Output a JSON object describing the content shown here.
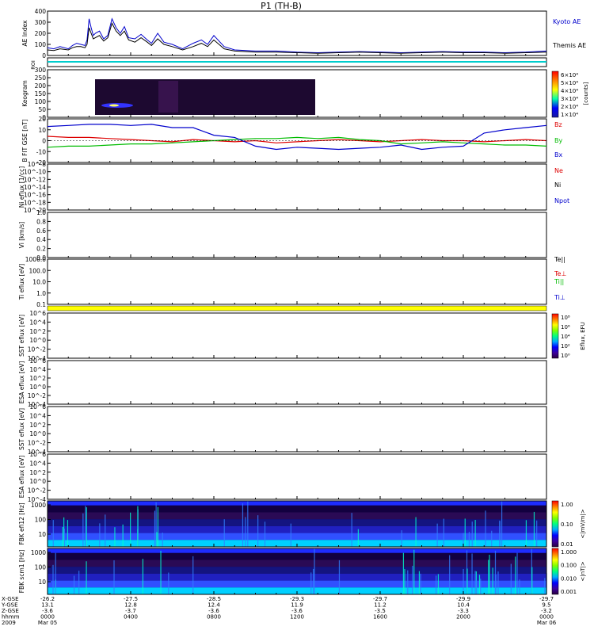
{
  "title": "P1 (TH-B)",
  "chart_data": [
    {
      "type": "line",
      "panel": "ae",
      "ylabel": "AE Index",
      "ylim": [
        0,
        400
      ],
      "y_ticks": [
        "0",
        "100",
        "200",
        "300",
        "400"
      ],
      "series": [
        {
          "name": "Kyoto AE",
          "color": "#0000cc",
          "x": [
            0,
            0.3,
            0.6,
            1.0,
            1.2,
            1.4,
            1.6,
            1.8,
            1.9,
            2.0,
            2.1,
            2.2,
            2.3,
            2.5,
            2.7,
            2.9,
            3.1,
            3.3,
            3.5,
            3.7,
            3.9,
            4.2,
            4.5,
            4.8,
            5.0,
            5.3,
            5.6,
            6.0,
            6.5,
            7.0,
            7.4,
            7.7,
            8.0,
            8.5,
            9,
            10,
            11,
            12,
            13,
            14,
            15,
            16,
            17,
            18,
            19,
            20,
            21,
            22,
            23,
            24
          ],
          "y": [
            70,
            60,
            80,
            60,
            90,
            110,
            100,
            90,
            140,
            330,
            250,
            180,
            200,
            220,
            150,
            180,
            330,
            250,
            200,
            260,
            160,
            150,
            190,
            140,
            110,
            200,
            120,
            100,
            60,
            110,
            140,
            100,
            180,
            80,
            50,
            40,
            40,
            30,
            25,
            30,
            35,
            30,
            25,
            30,
            35,
            30,
            30,
            25,
            30,
            40
          ]
        },
        {
          "name": "Themis AE",
          "color": "#000000",
          "x": [
            0,
            0.3,
            0.6,
            1.0,
            1.2,
            1.4,
            1.6,
            1.8,
            1.9,
            2.0,
            2.1,
            2.2,
            2.3,
            2.5,
            2.7,
            2.9,
            3.1,
            3.3,
            3.5,
            3.7,
            3.9,
            4.2,
            4.5,
            4.8,
            5.0,
            5.3,
            5.6,
            6.0,
            6.5,
            7.0,
            7.4,
            7.7,
            8.0,
            8.5,
            9,
            10,
            11,
            12,
            13,
            14,
            15,
            16,
            17,
            18,
            19,
            20,
            21,
            22,
            23,
            24
          ],
          "y": [
            50,
            45,
            60,
            50,
            70,
            80,
            80,
            70,
            100,
            250,
            200,
            150,
            160,
            180,
            130,
            160,
            290,
            220,
            180,
            220,
            140,
            120,
            160,
            120,
            90,
            150,
            100,
            80,
            50,
            80,
            110,
            80,
            140,
            60,
            40,
            30,
            30,
            25,
            20,
            25,
            30,
            25,
            20,
            25,
            30,
            25,
            25,
            20,
            25,
            30
          ]
        }
      ]
    },
    {
      "type": "line",
      "panel": "bfgm",
      "ylabel": "B FIT GSE [nT]",
      "ylim": [
        -20,
        20
      ],
      "y_ticks": [
        "20",
        "10",
        "0",
        "-10",
        "-20"
      ],
      "series": [
        {
          "name": "Bz",
          "color": "#dd0000",
          "x": [
            0,
            1,
            2,
            3,
            4,
            5,
            6,
            7,
            8,
            9,
            10,
            11,
            12,
            13,
            14,
            15,
            16,
            17,
            18,
            19,
            20,
            21,
            22,
            23,
            24
          ],
          "y": [
            4,
            3,
            3,
            2,
            1,
            0,
            -1,
            1,
            0,
            -1,
            0,
            -2,
            -1,
            0,
            1,
            0,
            -1,
            0,
            1,
            0,
            0,
            -1,
            0,
            1,
            0
          ]
        },
        {
          "name": "By",
          "color": "#00bb00",
          "x": [
            0,
            1,
            2,
            3,
            4,
            5,
            6,
            7,
            8,
            9,
            10,
            11,
            12,
            13,
            14,
            15,
            16,
            17,
            18,
            19,
            20,
            21,
            22,
            23,
            24
          ],
          "y": [
            -6,
            -5,
            -5,
            -4,
            -3,
            -3,
            -2,
            -1,
            0,
            1,
            2,
            2,
            3,
            2,
            3,
            1,
            0,
            -3,
            -2,
            -1,
            -2,
            -3,
            -4,
            -4,
            -5
          ]
        },
        {
          "name": "Bx",
          "color": "#0000cc",
          "x": [
            0,
            1,
            2,
            3,
            4,
            5,
            6,
            7,
            8,
            9,
            10,
            11,
            12,
            13,
            14,
            15,
            16,
            17,
            18,
            19,
            20,
            21,
            22,
            23,
            24
          ],
          "y": [
            13,
            14,
            15,
            15,
            14,
            15,
            12,
            12,
            5,
            3,
            -5,
            -8,
            -6,
            -7,
            -8,
            -7,
            -6,
            -4,
            -8,
            -6,
            -5,
            7,
            10,
            12,
            14
          ]
        }
      ]
    },
    {
      "type": "line",
      "panel": "ni",
      "ylabel": "Ni eflux [1/cc]",
      "y_ticks": [
        "10^-8",
        "10^-10",
        "10^-12",
        "10^-14",
        "10^-16",
        "10^-18",
        "10^-20"
      ],
      "series": [
        {
          "name": "Ne",
          "color": "#dd0000"
        },
        {
          "name": "Ni",
          "color": "#000000"
        },
        {
          "name": "Npot",
          "color": "#0000cc"
        }
      ]
    },
    {
      "type": "line",
      "panel": "vi",
      "ylabel": "Vi [km/s]",
      "ylim": [
        0,
        1
      ],
      "y_ticks": [
        "1.0",
        "0.8",
        "0.6",
        "0.4",
        "0.2",
        "0.0"
      ]
    },
    {
      "type": "line",
      "panel": "ti",
      "ylabel": "Ti eflux [eV]",
      "y_ticks": [
        "1000.0",
        "100.0",
        "10.0",
        "1.0",
        "0.1"
      ],
      "series": [
        {
          "name": "Te||",
          "color": "#000000"
        },
        {
          "name": "Te⊥",
          "color": "#dd0000"
        },
        {
          "name": "Ti||",
          "color": "#00bb00"
        },
        {
          "name": "Ti⊥",
          "color": "#0000cc"
        }
      ]
    },
    {
      "type": "heatmap",
      "panel": "sst_e",
      "ylabel": "SST eflux [eV]",
      "y_ticks": [
        "10^6",
        "10^4",
        "10^2",
        "10^0",
        "10^-2",
        "10^-4"
      ]
    },
    {
      "type": "heatmap",
      "panel": "esa_e",
      "ylabel": "ESA eflux [eV]",
      "y_ticks": [
        "10^6",
        "10^4",
        "10^2",
        "10^0",
        "10^-2",
        "10^-4"
      ]
    },
    {
      "type": "heatmap",
      "panel": "sst_i",
      "ylabel": "SST eflux [eV]",
      "y_ticks": [
        "10^6",
        "10^4",
        "10^2",
        "10^0",
        "10^-2",
        "10^-4"
      ]
    },
    {
      "type": "heatmap",
      "panel": "esa_i",
      "ylabel": "ESA eflux [eV]",
      "y_ticks": [
        "10^6",
        "10^4",
        "10^2",
        "10^0",
        "10^-2",
        "10^-4"
      ]
    }
  ],
  "panels": {
    "roi": {
      "label": "ROI"
    },
    "keogram": {
      "label": "Keogram",
      "y_ticks": [
        "300",
        "250",
        "200",
        "150",
        "100",
        "50",
        "0"
      ],
      "colorbar": {
        "label": "[counts]",
        "ticks": [
          "6×10⁴",
          "5×10⁴",
          "4×10⁴",
          "3×10⁴",
          "2×10⁴",
          "1×10⁴"
        ]
      }
    },
    "eflux_colorbar": {
      "label": "Eflux, EFU",
      "ticks": [
        "10⁸",
        "10⁶",
        "10⁴",
        "10²",
        "10⁰"
      ]
    },
    "fbk1": {
      "label": "FBK efi12 [Hz]",
      "y_ticks": [
        "1000",
        "100",
        "10"
      ],
      "colorbar": {
        "label": "<|mV/m|>",
        "ticks": [
          "1.00",
          "0.10",
          "0.01"
        ]
      }
    },
    "fbk2": {
      "label": "FBK scm1 [Hz]",
      "y_ticks": [
        "1000",
        "100",
        "10"
      ],
      "colorbar": {
        "label": "<|nT|>",
        "ticks": [
          "1.000",
          "0.100",
          "0.010",
          "0.001"
        ]
      }
    }
  },
  "x_axis": {
    "row_labels": [
      "X-GSE",
      "Y-GSE",
      "Z-GSE",
      "hhmm",
      "2009"
    ],
    "columns": [
      {
        "x": 0,
        "vals": [
          "-26.2",
          "13.1",
          "-3.6",
          "0000",
          "Mar 05"
        ]
      },
      {
        "x": 4,
        "vals": [
          "-27.5",
          "12.8",
          "-3.7",
          "0400",
          ""
        ]
      },
      {
        "x": 8,
        "vals": [
          "-28.5",
          "12.4",
          "-3.6",
          "0800",
          ""
        ]
      },
      {
        "x": 12,
        "vals": [
          "-29.3",
          "11.9",
          "-3.6",
          "1200",
          ""
        ]
      },
      {
        "x": 16,
        "vals": [
          "-29.7",
          "11.2",
          "-3.5",
          "1600",
          ""
        ]
      },
      {
        "x": 20,
        "vals": [
          "-29.9",
          "10.4",
          "-3.3",
          "2000",
          ""
        ]
      },
      {
        "x": 24,
        "vals": [
          "-29.7",
          "9.5",
          "-3.2",
          "0000",
          "Mar 06"
        ]
      }
    ]
  }
}
